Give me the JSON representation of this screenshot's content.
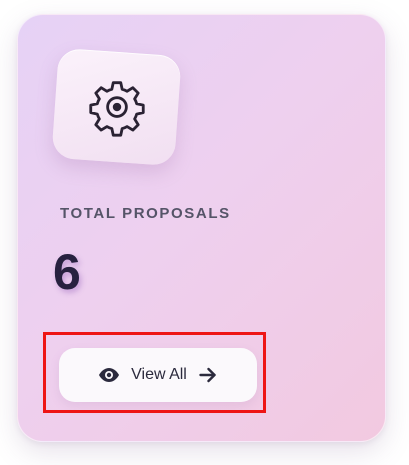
{
  "stat_card": {
    "title": "TOTAL PROPOSALS",
    "value": "6",
    "icon": "gear-icon",
    "button": {
      "label": "View All",
      "leading_icon": "eye-icon",
      "trailing_icon": "arrow-right-icon"
    }
  },
  "colors": {
    "card_gradient_start": "#e6d2f6",
    "card_gradient_end": "#f2c9e0",
    "title_text": "#555468",
    "value_text": "#27213f",
    "button_bg": "#fbf9fc",
    "highlight": "#ee1515"
  }
}
